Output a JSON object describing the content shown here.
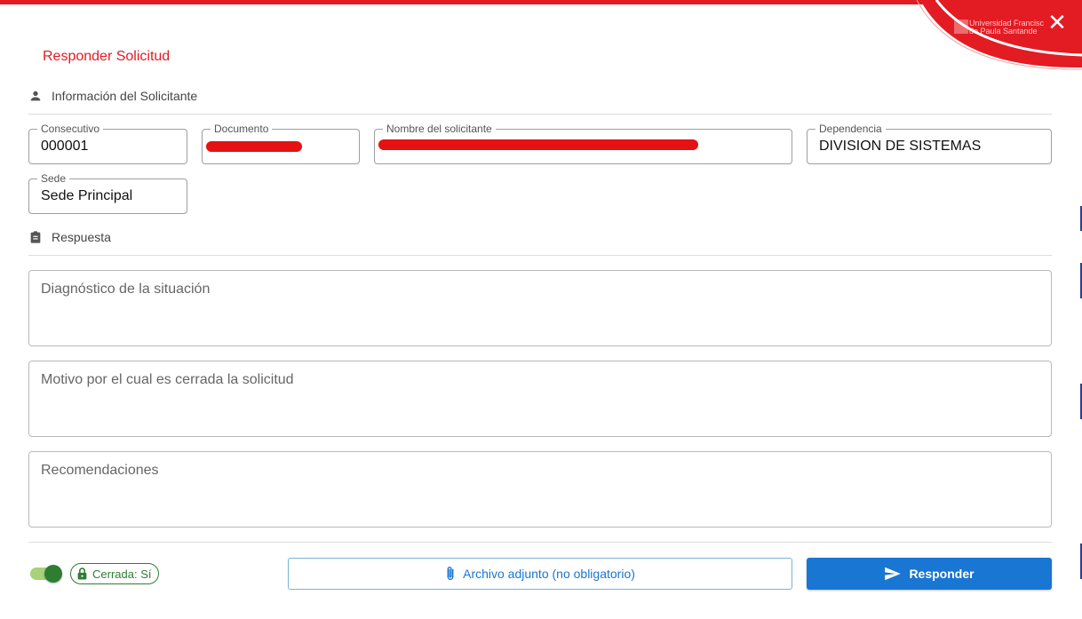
{
  "dialog": {
    "title": "Responder Solicitud",
    "close_icon": "close-icon",
    "brand_color": "#e31b23",
    "logo": {
      "line1": "Universidad Francisc",
      "line2": "de Paula Santande"
    }
  },
  "solicitante": {
    "section_label": "Información del Solicitante",
    "icon": "person-icon",
    "fields": {
      "consecutivo": {
        "label": "Consecutivo",
        "value": "000001"
      },
      "documento": {
        "label": "Documento",
        "value": ""
      },
      "nombre": {
        "label": "Nombre del solicitante",
        "value": ""
      },
      "dependencia": {
        "label": "Dependencia",
        "value": "DIVISION DE SISTEMAS"
      },
      "sede": {
        "label": "Sede",
        "value": "Sede Principal"
      }
    }
  },
  "respuesta": {
    "section_label": "Respuesta",
    "icon": "clipboard-icon",
    "diagnostico_placeholder": "Diagnóstico de la situación",
    "motivo_placeholder": "Motivo por el cual es cerrada la solicitud",
    "recomendaciones_placeholder": "Recomendaciones"
  },
  "footer": {
    "toggle_on": true,
    "chip_label": "Cerrada: Sí",
    "chip_icon": "lock-icon",
    "attach_label": "Archivo adjunto (no obligatorio)",
    "attach_icon": "paperclip-icon",
    "submit_label": "Responder",
    "submit_icon": "send-icon",
    "primary_color": "#1976d2",
    "success_color": "#2e7d32"
  }
}
